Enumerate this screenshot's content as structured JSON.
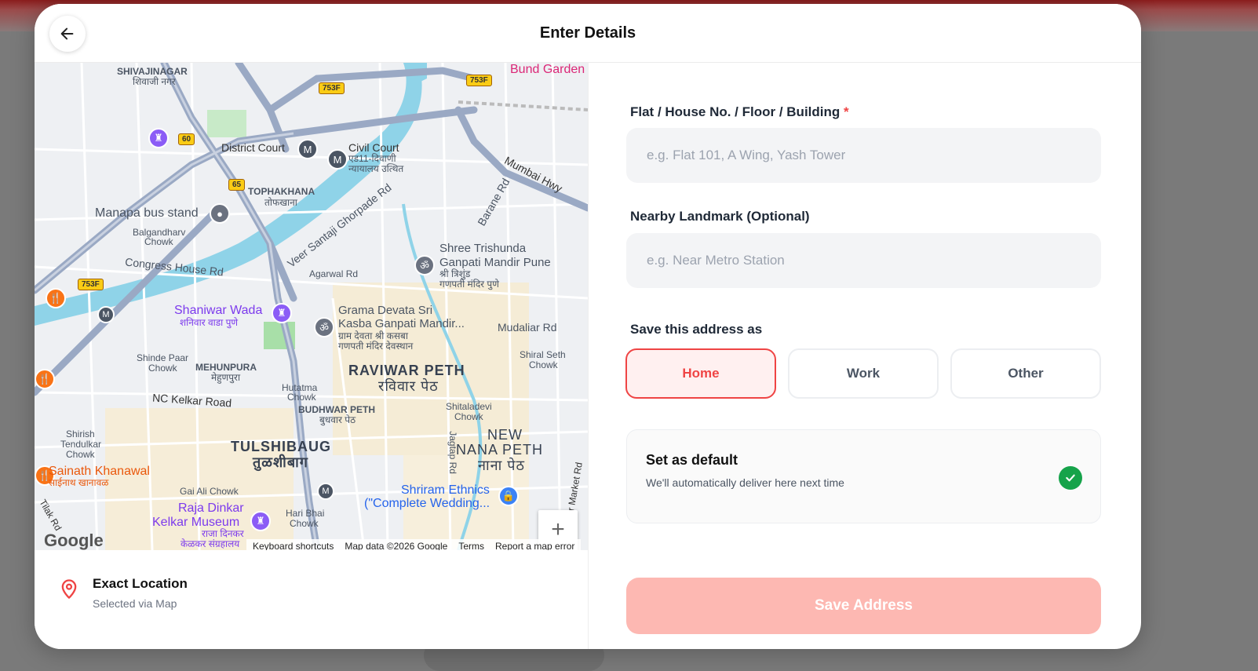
{
  "header": {
    "title": "Enter Details"
  },
  "map": {
    "labels": {
      "shivajinagar": "SHIVAJINAGAR",
      "shivajinagar_mr": "शिवाजी नगर",
      "district_court": "District Court",
      "civil_court": "Civil Court",
      "civil_court_mr": "एड11-दिवाणी",
      "civil_court_mr2": "न्यायालय उत्थित",
      "mumbai_hwy": "Mumbai Hwy",
      "tophakhana": "TOPHAKHANA",
      "tophakhana_mr": "तोफखाना",
      "manapa": "Manapa bus stand",
      "balgandharv": "Balgandharv",
      "balgandharv2": "Chowk",
      "congress_house": "Congress House Rd",
      "santaji": "Veer Santaji Ghorpade Rd",
      "barane": "Barane Rd",
      "agarwal": "Agarwal Rd",
      "trishunda": "Shree Trishunda",
      "trishunda2": "Ganpati Mandir Pune",
      "trishunda_mr": "श्री त्रिशुंड",
      "trishunda_mr2": "गणपती मंदिर पुणे",
      "shaniwar": "Shaniwar Wada",
      "shaniwar_mr": "शनिवार वाडा पुणे",
      "grama": "Grama Devata Sri",
      "grama2": "Kasba Ganpati Mandir...",
      "grama_mr": "ग्राम देवता श्री कसबा",
      "grama_mr2": "गणपती मंदिर देवस्थान",
      "mudaliar": "Mudaliar Rd",
      "shiral": "Shiral Seth",
      "shiral2": "Chowk",
      "shinde": "Shinde Paar",
      "shinde2": "Chowk",
      "mehunpura": "MEHUNPURA",
      "mehunpura_mr": "मेहुणपुरा",
      "raviwar": "RAVIWAR PETH",
      "raviwar_mr": "रविवार पेठ",
      "kelkar_road": "NC Kelkar Road",
      "hutatma": "Hutatma",
      "hutatma2": "Chowk",
      "budhwar": "BUDHWAR PETH",
      "budhwar_mr": "बुधवार पेठ",
      "shitaladevi": "Shitaladevi",
      "shitaladevi2": "Chowk",
      "shirish": "Shirish",
      "shirish2": "Tendulkar",
      "shirish3": "Chowk",
      "tulshibaug": "TULSHIBAUG",
      "tulshibaug_mr": "तुळशीबाग",
      "jagtap": "Jagtap Rd",
      "new_nana": "NEW",
      "new_nana2": "NANA PETH",
      "new_nana_mr": "नाना पेठ",
      "sainath": "Sainath Khanawal",
      "sainath_mr": "साईनाथ खानावळ",
      "gai_ali": "Gai Ali Chowk",
      "raja": "Raja Dinkar",
      "raja2": "Kelkar Museum",
      "raja_mr": "राजा दिनकर",
      "raja_mr2": "केळकर संग्रहालय",
      "hari": "Hari Bhai",
      "hari2": "Chowk",
      "shriram": "Shriram Ethnics",
      "shriram2": "(\"Complete Wedding...",
      "bund": "Bund Garden",
      "market": "ber Market Rd",
      "tilak": "Tilak Rd"
    },
    "shields": {
      "s753f_a": "753F",
      "s753f_b": "753F",
      "s753f_c": "753F",
      "s60": "60",
      "s65": "65"
    },
    "google": "Google",
    "attribution": {
      "shortcuts": "Keyboard shortcuts",
      "data": "Map data ©2026 Google",
      "terms": "Terms",
      "report": "Report a map error"
    },
    "zoom_in": "+",
    "zoom_out": "−"
  },
  "location": {
    "title": "Exact Location",
    "subtitle": "Selected via Map"
  },
  "form": {
    "flat_label": "Flat / House No. / Floor / Building",
    "required_mark": "*",
    "flat_placeholder": "e.g. Flat 101, A Wing, Yash Tower",
    "landmark_label": "Nearby Landmark (Optional)",
    "landmark_placeholder": "e.g. Near Metro Station",
    "save_as_label": "Save this address as",
    "types": [
      "Home",
      "Work",
      "Other"
    ],
    "selected_type": "Home",
    "default_title": "Set as default",
    "default_desc": "We'll automatically deliver here next time",
    "default_checked": true,
    "save_button": "Save Address"
  },
  "colors": {
    "accent": "#ef4444",
    "save_disabled": "#fdb8b2",
    "check": "#16a34a"
  }
}
